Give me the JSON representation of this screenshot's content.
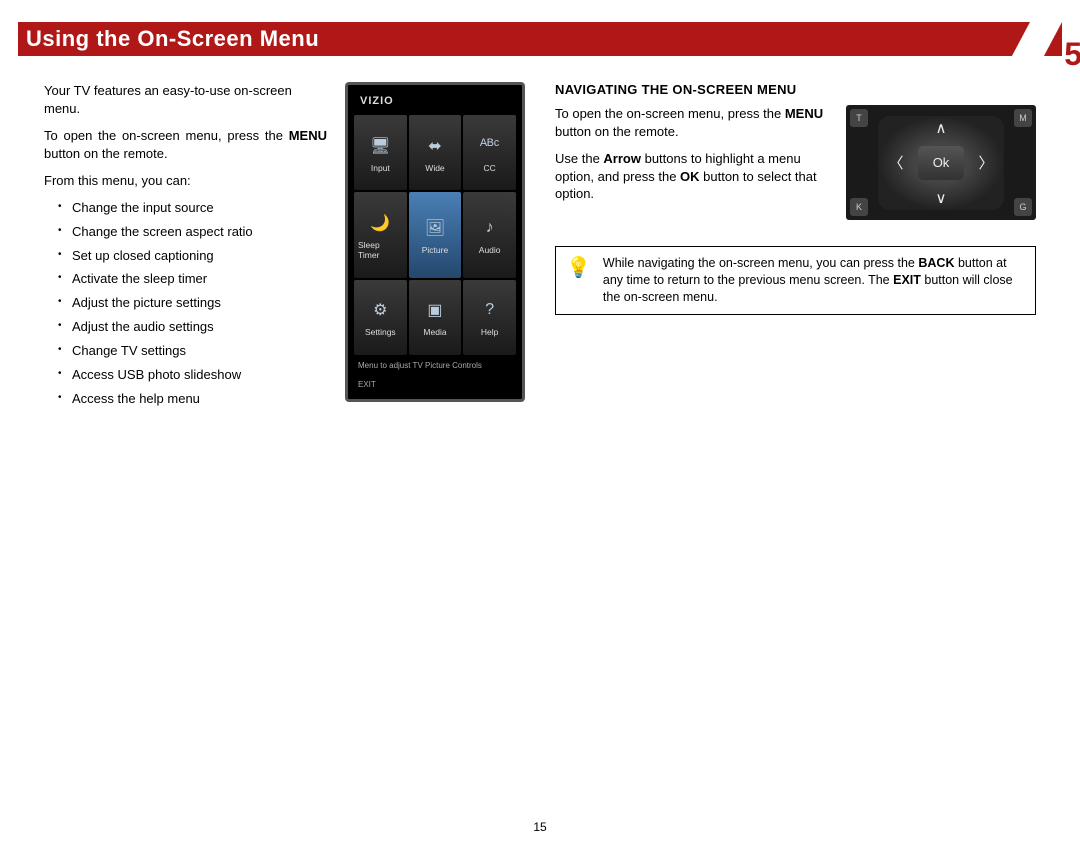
{
  "header": {
    "title": "Using the On-Screen Menu",
    "chapter": "5"
  },
  "left": {
    "intro1": "Your TV features an easy-to-use on-screen menu.",
    "intro2a": "To open the on-screen menu, press the ",
    "intro2b": "MENU",
    "intro2c": " button on the remote.",
    "intro3": "From this menu, you can:",
    "bullets": [
      "Change the input source",
      "Change the screen aspect ratio",
      "Set up closed captioning",
      "Activate the sleep timer",
      "Adjust the picture settings",
      "Adjust the audio settings",
      "Change TV settings",
      "Access USB photo slideshow",
      "Access the help menu"
    ]
  },
  "tv": {
    "logo": "VIZIO",
    "cells": [
      {
        "icon": "🖥",
        "label": "Input"
      },
      {
        "icon": "⬌",
        "label": "Wide"
      },
      {
        "icon": "ᴬᴮᶜ",
        "label": "CC"
      },
      {
        "icon": "🌙",
        "label": "Sleep Timer"
      },
      {
        "icon": "🖼",
        "label": "Picture",
        "selected": true
      },
      {
        "icon": "♪",
        "label": "Audio"
      },
      {
        "icon": "⚙",
        "label": "Settings"
      },
      {
        "icon": "▣",
        "label": "Media"
      },
      {
        "icon": "?",
        "label": "Help"
      }
    ],
    "status": "Menu to adjust TV Picture Controls",
    "exit": "EXIT"
  },
  "right": {
    "heading": "NAVIGATING THE ON-SCREEN MENU",
    "p1a": "To open the on-screen menu, press the ",
    "p1b": "MENU",
    "p1c": " button on the remote.",
    "p2a": "Use the ",
    "p2b": "Arrow",
    "p2c": " buttons to highlight a menu option, and press the ",
    "p2d": "OK",
    "p2e": " button to select that option.",
    "remote": {
      "ok": "Ok",
      "tl": "T",
      "tr": "M",
      "bl": "K",
      "br": "G"
    },
    "tip": {
      "a": "While navigating the on-screen menu, you can press the ",
      "b": "BACK",
      "c": " button at any time to return to the previous menu screen. The ",
      "d": "EXIT",
      "e": " button will close the on-screen menu."
    }
  },
  "pagenum": "15"
}
